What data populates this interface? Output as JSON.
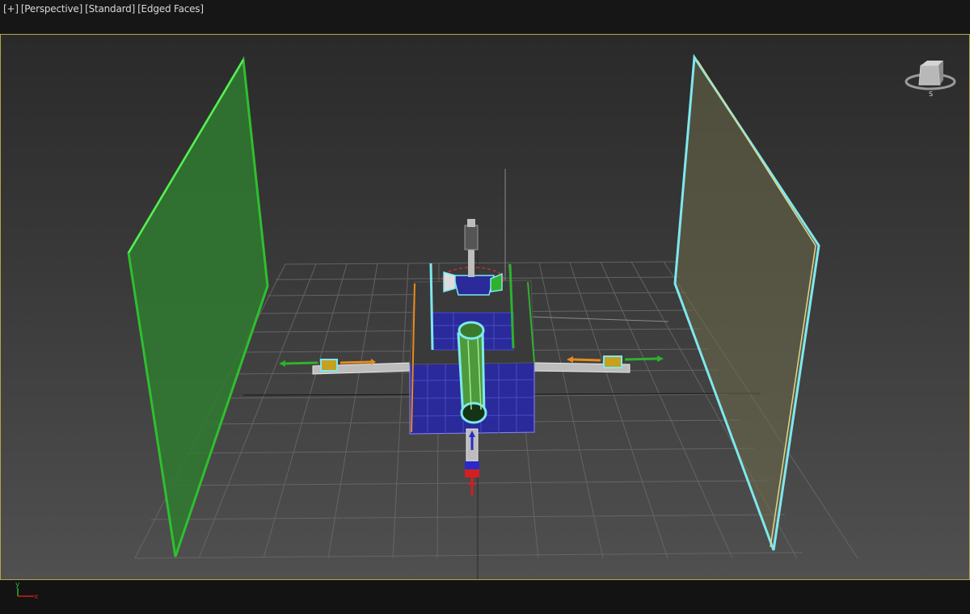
{
  "viewport": {
    "menu_label": "[+]",
    "view_label": "[Perspective]",
    "shading_label": "[Standard]",
    "display_label": "[Edged Faces]"
  },
  "viewcube": {
    "face_label": "S",
    "icon": "viewcube-icon"
  },
  "axis_tripod": {
    "y_label": "y",
    "x_label": "x"
  },
  "colors": {
    "viewport_border": "#b0a84a",
    "grid_line": "#6a6a6a",
    "left_plane": "#2f7a2f",
    "left_plane_edge": "#2fbf2f",
    "right_plane_fill": "#6e6c4a",
    "right_plane_edge": "#7ee8ee",
    "box_blue": "#2a2a9a",
    "tube_green": "#4c9a3a",
    "selection_cyan": "#7ee8ee",
    "arrow_green": "#2fb02f",
    "arrow_orange": "#e88a1a",
    "gizmo_red": "#d02020"
  }
}
